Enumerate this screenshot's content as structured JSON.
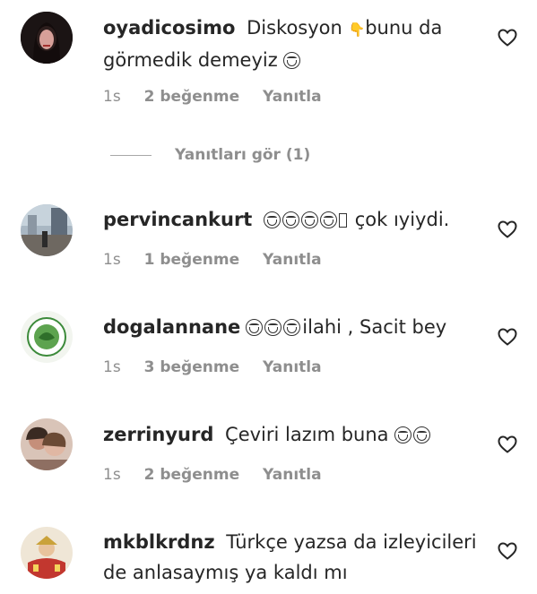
{
  "comments": [
    {
      "username": "oyadicosimo",
      "text_before": "Diskosyon ",
      "emoji_a": "👇",
      "text_after": "bunu da görmedik demeyiz ",
      "emoji_b": "😂",
      "time": "1s",
      "likes": "2 beğenme",
      "reply": "Yanıtla",
      "avatar_icon": "profile-photo-woman"
    },
    {
      "username": "pervincankurt",
      "text": "çok ıyiydi.",
      "time": "1s",
      "likes": "1 beğenme",
      "reply": "Yanıtla",
      "avatar_icon": "profile-photo-street"
    },
    {
      "username": "dogalannane",
      "text": "ilahi , Sacit bey",
      "time": "1s",
      "likes": "3 beğenme",
      "reply": "Yanıtla",
      "avatar_icon": "profile-logo-green"
    },
    {
      "username": "zerrinyurd",
      "text": "Çeviri lazım buna ",
      "time": "1s",
      "likes": "2 beğenme",
      "reply": "Yanıtla",
      "avatar_icon": "profile-photo-couple"
    },
    {
      "username": "mkblkrdnz",
      "text": "Türkçe yazsa da izleyicileri de anlasaymış ya kaldı mı",
      "avatar_icon": "profile-photo-cartoon"
    }
  ],
  "view_replies": "Yanıtları gör (1)",
  "colors": {
    "meta": "#8e8e8e",
    "text": "#262626",
    "heart_stroke": "#262626"
  }
}
